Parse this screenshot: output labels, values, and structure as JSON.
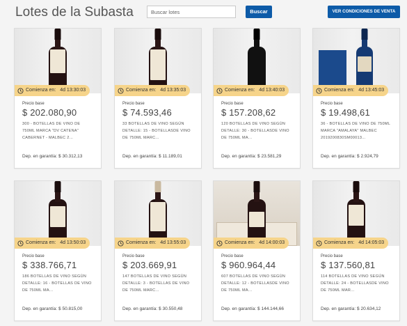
{
  "page": {
    "title": "Lotes de la Subasta"
  },
  "search": {
    "placeholder": "Buscar lotes",
    "button_label": "Buscar"
  },
  "header": {
    "conditions_label": "VER CONDICIONES DE VENTA"
  },
  "lot_labels": {
    "starts": "Comienza en:",
    "base_price": "Precio base",
    "deposit": "Dep. en garantía:"
  },
  "lots": [
    {
      "countdown": "4d 13:30:03",
      "price": "$ 202.080,90",
      "desc1": "300 - BOTELLAS DE VINO DE",
      "desc2": "750ML MARCA \"DV CATENA\"",
      "desc3": "CABERNET - MALBEC 2...",
      "deposit": "$ 30.312,13",
      "image_icon": "wine-bottle-icon"
    },
    {
      "countdown": "4d 13:35:03",
      "price": "$ 74.593,46",
      "desc1": "33 BOTELLAS DE VINO SEGÚN",
      "desc2": "DETALLE: 15 - BOTELLASDE VINO",
      "desc3": "DE 750ML MARC...",
      "deposit": "$ 11.189,01",
      "image_icon": "wine-bottle-icon"
    },
    {
      "countdown": "4d 13:40:03",
      "price": "$ 157.208,62",
      "desc1": "120 BOTELLAS DE VINO SEGÚN",
      "desc2": "DETALLE: 30 - BOTELLASDE VINO",
      "desc3": "DE 750ML MA...",
      "deposit": "$ 23.581,29",
      "image_icon": "wine-bottle-icon"
    },
    {
      "countdown": "4d 13:45:03",
      "price": "$ 19.498,61",
      "desc1": "36 - BOTELLAS DE VINO DE 750ML",
      "desc2": "MARCA \"AMALAYA\" MALBEC",
      "desc3": "2019200830SM00013...",
      "deposit": "$ 2.924,79",
      "image_icon": "wine-bottle-icon"
    },
    {
      "countdown": "4d 13:50:03",
      "price": "$ 338.766,71",
      "desc1": "186 BOTELLAS DE VINO SEGÚN",
      "desc2": "DETALLE: 16 - BOTELLAS DE VINO",
      "desc3": "DE 750ML MA...",
      "deposit": "$ 50.815,00",
      "image_icon": "wine-bottle-icon"
    },
    {
      "countdown": "4d 13:55:03",
      "price": "$ 203.669,91",
      "desc1": "147 BOTELLAS DE VINO SEGÚN",
      "desc2": "DETALLE: 3 - BOTELLAS DE VINO",
      "desc3": "DE 750ML MARC...",
      "deposit": "$ 30.550,48",
      "image_icon": "wine-bottle-icon"
    },
    {
      "countdown": "4d 14:00:03",
      "price": "$ 960.964,44",
      "desc1": "607 BOTELLAS DE VINO SEGÚN",
      "desc2": "DETALLE: 12 - BOTELLASDE VINO",
      "desc3": "DE 750ML MA...",
      "deposit": "$ 144.144,66",
      "image_icon": "wine-box-icon"
    },
    {
      "countdown": "4d 14:05:03",
      "price": "$ 137.560,81",
      "desc1": "114 BOTELLAS DE VINO SEGÚN",
      "desc2": "DETALLE: 24 - BOTELLASDE VINO",
      "desc3": "DE 750ML MAR...",
      "deposit": "$ 20.634,12",
      "image_icon": "wine-bottle-icon"
    }
  ],
  "colors": {
    "accent": "#0d5ba8",
    "badge": "#f6d48a",
    "background": "#f4f4f4",
    "bottle": "#241212"
  }
}
